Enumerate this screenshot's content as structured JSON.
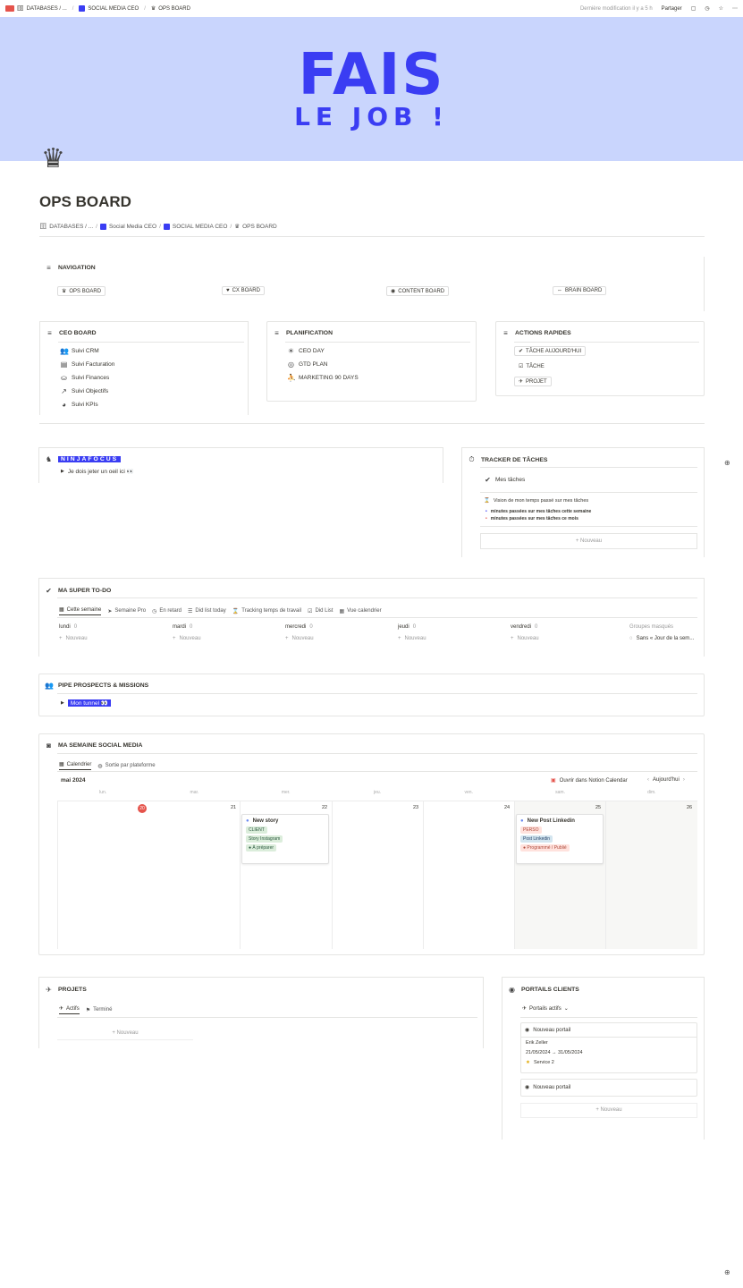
{
  "topbar": {
    "crumbs": [
      "DATABASES / ...",
      "SOCIAL MEDIA CEO",
      "OPS BOARD"
    ],
    "edited": "Dernière modification il y a 5 h",
    "share": "Partager"
  },
  "cover": {
    "line1": "FAIS",
    "line2": "LE JOB !"
  },
  "page": {
    "title": "OPS BOARD",
    "breadcrumb": [
      "DATABASES / ...",
      "Social Media CEO",
      "SOCIAL MEDIA CEO",
      "OPS BOARD"
    ]
  },
  "navigation": {
    "title": "NAVIGATION",
    "items": [
      "OPS BOARD",
      "CX BOARD",
      "CONTENT BOARD",
      "BRAIN BOARD"
    ]
  },
  "ceo_board": {
    "title": "CEO BOARD",
    "items": [
      "Suivi CRM",
      "Suivi Facturation",
      "Suivi Finances",
      "Suivi Objectifs",
      "Suivi KPIs"
    ]
  },
  "planification": {
    "title": "PLANIFICATION",
    "items": [
      "CEO DAY",
      "GTD PLAN",
      "MARKETING 90 DAYS"
    ]
  },
  "actions_rapides": {
    "title": "ACTIONS RAPIDES",
    "items": [
      "TÂCHE AUJOURD'HUI",
      "TÂCHE",
      "PROJET"
    ]
  },
  "ninjafocus": {
    "title": "NINJAFOCUS",
    "toggle": "Je dois jeter un oeil ici 👀"
  },
  "tracker": {
    "title": "TRACKER DE TÂCHES",
    "tasks": "Mes tâches",
    "vision": "Vision de mon temps passé sur mes tâches",
    "week": "minutes passées sur mes tâches cette semaine",
    "month": "minutes passées sur mes tâches ce mois",
    "new": "+ Nouveau"
  },
  "todo": {
    "title": "MA SUPER TO-DO",
    "tabs": [
      "Cette semaine",
      "Semaine Pro",
      "En retard",
      "Did list today",
      "Tracking temps de travail",
      "Did List",
      "Vue calendrier"
    ],
    "days": [
      "lundi",
      "mardi",
      "mercredi",
      "jeudi",
      "vendredi"
    ],
    "counts": [
      "0",
      "0",
      "0",
      "0",
      "0"
    ],
    "new": "Nouveau",
    "hidden_groups": "Groupes masqués",
    "no_date": "Sans « Jour de la sem..."
  },
  "pipe": {
    "title": "PIPE PROSPECTS & MISSIONS",
    "toggle": "Mon tunnel 👀"
  },
  "social": {
    "title": "MA SEMAINE SOCIAL MEDIA",
    "tabs": [
      "Calendrier",
      "Sortie par plateforme"
    ],
    "month": "mai 2024",
    "open_btn": "Ouvrir dans Notion Calendar",
    "today_btn": "Aujourd'hui",
    "weekdays": [
      "lun.",
      "mar.",
      "mer.",
      "jeu.",
      "ven.",
      "sam.",
      "dim."
    ],
    "dates": [
      "20",
      "21",
      "22",
      "23",
      "24",
      "25",
      "26"
    ],
    "card1": {
      "title": "New story",
      "tags": [
        "CLIENT",
        "Story Instagram",
        "À préparer"
      ]
    },
    "card2": {
      "title": "New Post Linkedin",
      "tags": [
        "PERSO",
        "Post Linkedin",
        "Programmé / Publié"
      ]
    }
  },
  "projets": {
    "title": "PROJETS",
    "tabs": [
      "Actifs",
      "Terminé"
    ],
    "new": "+ Nouveau"
  },
  "portails": {
    "title": "PORTAILS CLIENTS",
    "tab": "Portails actifs",
    "card1": {
      "title": "Nouveau portail",
      "person": "Erik Zeller",
      "dates": "21/05/2024 → 31/05/2024",
      "service": "Service 2"
    },
    "card2": {
      "title": "Nouveau portail"
    },
    "new": "+ Nouveau"
  },
  "colors": {
    "cover_bg": "#c9d5fd",
    "accent": "#3a3df3",
    "today_red": "#e5534b"
  }
}
